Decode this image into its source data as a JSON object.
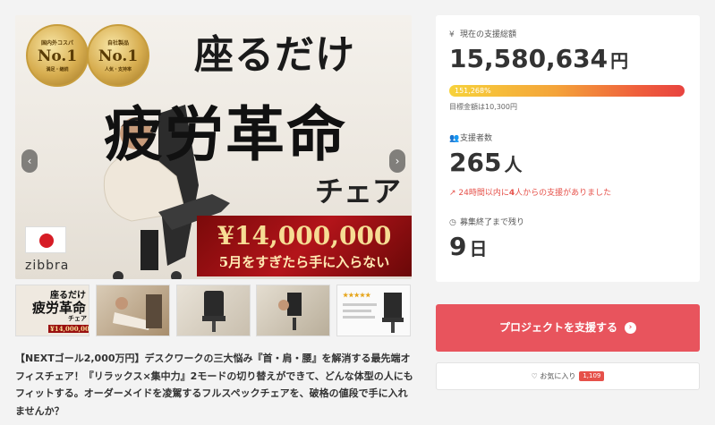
{
  "hero": {
    "badge1": {
      "top": "国内外コスパ",
      "rank": "No.1",
      "bottom": "満足・継続"
    },
    "badge2": {
      "top": "自社製品",
      "rank": "No.1",
      "bottom": "人気・支持率"
    },
    "headline1": "座るだけ",
    "headline2": "疲労革命",
    "headline3": "チェア",
    "price": "¥14,000,000",
    "price_sub": "5月をすぎたら手に入らない",
    "brand": "zibbra"
  },
  "thumbs": [
    {
      "line1": "座るだけ",
      "line2": "疲労革命",
      "line3": "チェア",
      "price": "¥14,000,000"
    },
    {},
    {},
    {},
    {
      "stars": "★★★★★"
    }
  ],
  "description": "【NEXTゴール2,000万円】デスクワークの三大悩み『首・肩・腰』を解消する最先端オフィスチェア！『リラックス×集中力』2モードの切り替えができて、どんな体型の人にもフィットする。オーダーメイドを凌駕するフルスペックチェアを、破格の値段で手に入れませんか？",
  "stats": {
    "amount_label": "現在の支援総額",
    "amount": "15,580,634",
    "amount_unit": "円",
    "percent": "151,268%",
    "goal": "目標金額は10,300円",
    "supporters_label": "支援者数",
    "supporters": "265",
    "supporters_unit": "人",
    "recent_pre": "24時間以内に",
    "recent_num": "4",
    "recent_post": "人からの支援がありました",
    "remaining_label": "募集終了まで残り",
    "remaining": "9",
    "remaining_unit": "日"
  },
  "support_button": "プロジェクトを支援する",
  "favorite": {
    "label": "お気に入り",
    "count": "1,109"
  },
  "colors": {
    "accent": "#e8545d",
    "bar_start": "#f7d23b",
    "bar_end": "#e8433f",
    "recent": "#e6514a"
  }
}
